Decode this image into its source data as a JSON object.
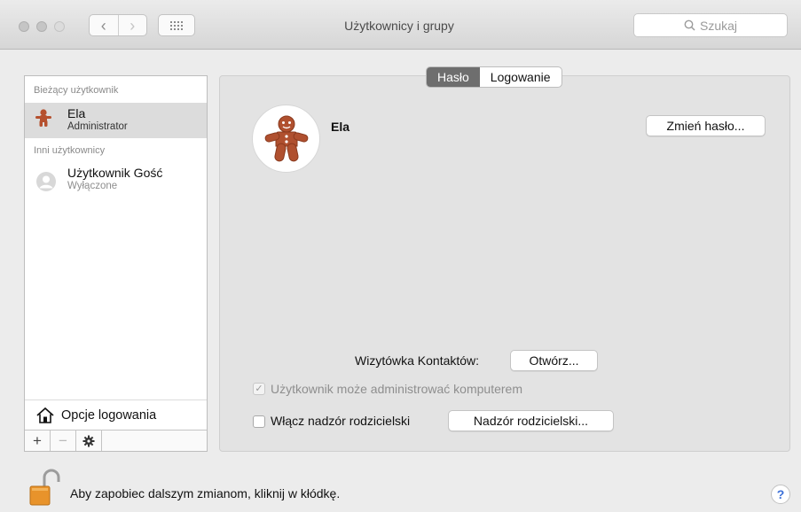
{
  "window": {
    "title": "Użytkownicy i grupy"
  },
  "toolbar": {
    "back_icon": "chevron-left-icon",
    "forward_icon": "chevron-right-icon",
    "grid_icon": "grid-icon",
    "search_placeholder": "Szukaj"
  },
  "sidebar": {
    "current_header": "Bieżący użytkownik",
    "current_user": {
      "name": "Ela",
      "role": "Administrator",
      "icon": "gingerbread-avatar-icon"
    },
    "others_header": "Inni użytkownicy",
    "other_users": [
      {
        "name": "Użytkownik Gość",
        "status": "Wyłączone",
        "icon": "guest-user-icon"
      }
    ],
    "login_options_label": "Opcje logowania",
    "footer": {
      "add": "+",
      "remove": "−",
      "gear_icon": "gear-icon"
    }
  },
  "main": {
    "tabs": [
      {
        "label": "Hasło",
        "active": true
      },
      {
        "label": "Logowanie",
        "active": false
      }
    ],
    "user_name": "Ela",
    "change_password_button": "Zmień hasło...",
    "contacts_card_label": "Wizytówka Kontaktów:",
    "open_button": "Otwórz...",
    "admin_checkbox_label": "Użytkownik może administrować komputerem",
    "admin_checked": true,
    "parental_checkbox_label": "Włącz nadzór rodzicielski",
    "parental_checked": false,
    "parental_button": "Nadzór rodzicielski..."
  },
  "bottom": {
    "lock_message": "Aby zapobiec dalszym zmianom, kliknij w kłódkę.",
    "help_label": "?"
  },
  "colors": {
    "active_tab": "#6e6e6e",
    "selection": "#dcdcdc",
    "lock_body": "#e8932b"
  }
}
